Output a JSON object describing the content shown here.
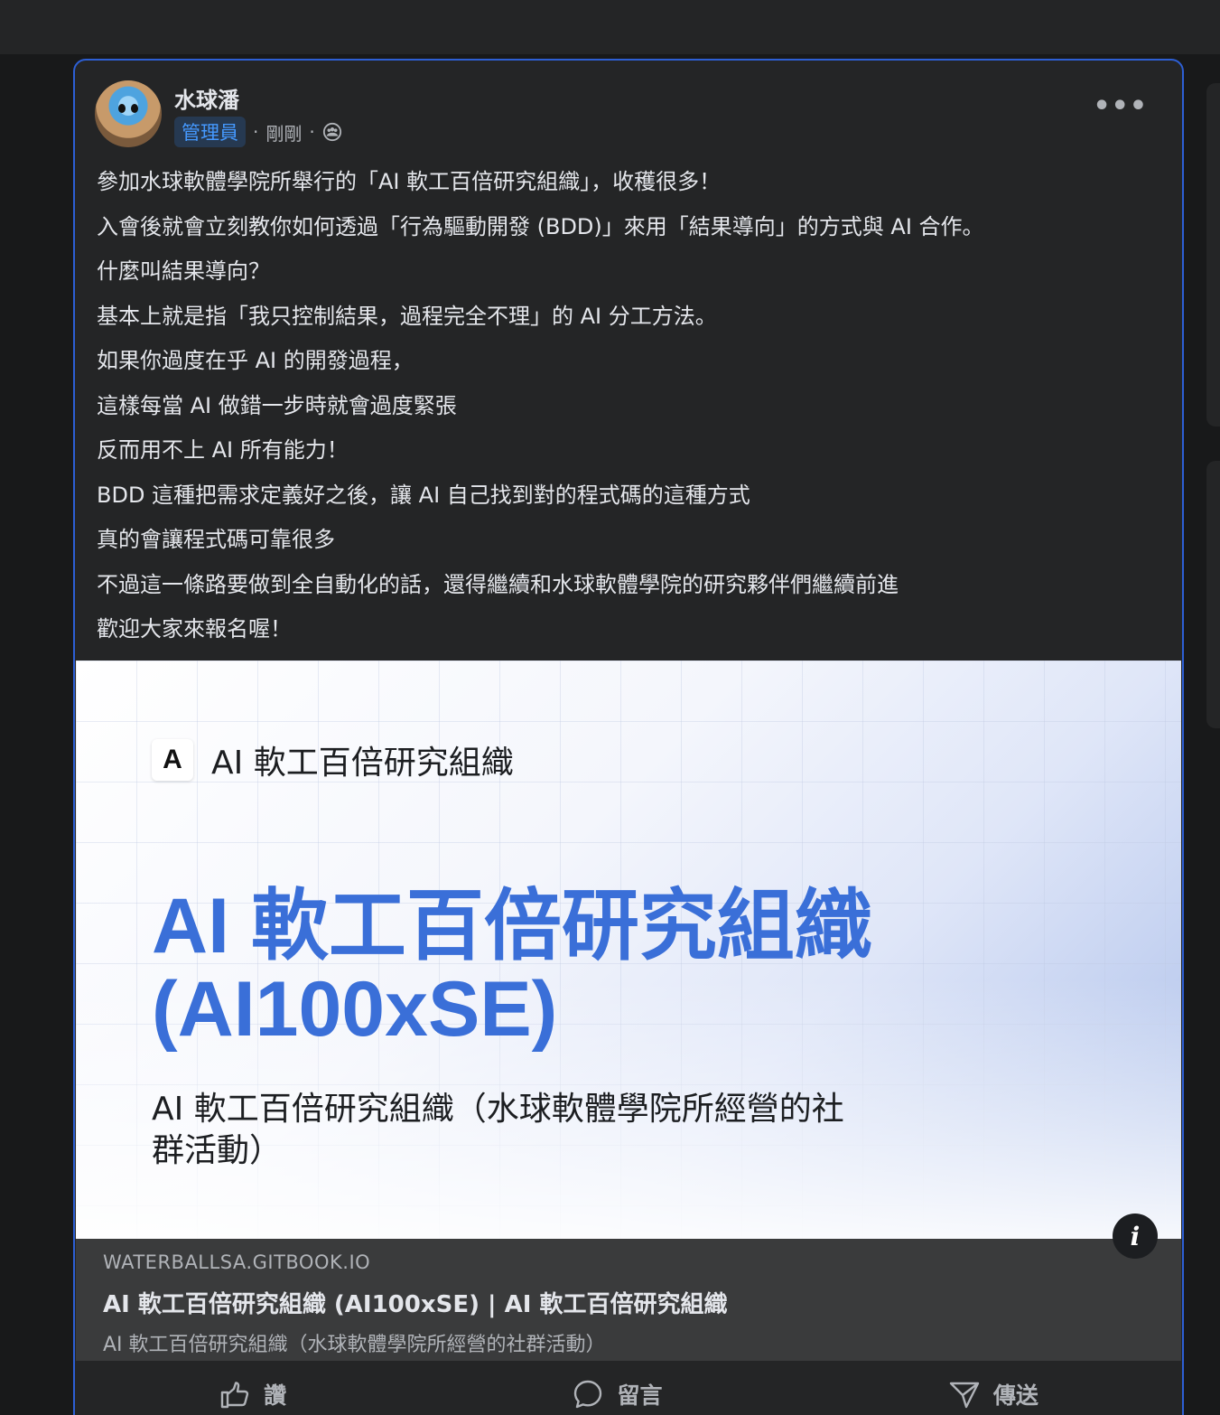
{
  "post": {
    "author": "水球潘",
    "role": "管理員",
    "timestamp": "剛剛",
    "separator": "·",
    "audience_icon": "group-icon",
    "more_label": "•••",
    "body_lines": [
      "參加水球軟體學院所舉行的「AI 軟工百倍研究組織」，收穫很多！",
      "入會後就會立刻教你如何透過「行為驅動開發 (BDD)」來用「結果導向」的方式與 AI 合作。",
      "什麼叫結果導向？",
      "基本上就是指「我只控制結果，過程完全不理」的 AI 分工方法。",
      "如果你過度在乎 AI 的開發過程，",
      "這樣每當 AI 做錯一步時就會過度緊張",
      "反而用不上 AI 所有能力！",
      "BDD 這種把需求定義好之後，讓 AI 自己找到對的程式碼的這種方式",
      "真的會讓程式碼可靠很多",
      "不過這一條路要做到全自動化的話，還得繼續和水球軟體學院的研究夥伴們繼續前進",
      "歡迎大家來報名喔！"
    ]
  },
  "preview": {
    "brand_logo": "A",
    "brand_name": "AI 軟工百倍研究組織",
    "hero_title": "AI 軟工百倍研究組織 (AI100xSE)",
    "hero_subtitle": "AI 軟工百倍研究組織（水球軟體學院所經營的社群活動）",
    "info_icon": "i"
  },
  "link": {
    "domain": "WATERBALLSA.GITBOOK.IO",
    "title": "AI 軟工百倍研究組織 (AI100xSE) | AI 軟工百倍研究組織",
    "description": "AI 軟工百倍研究組織（水球軟體學院所經營的社群活動）"
  },
  "actions": {
    "like": "讚",
    "comment": "留言",
    "share": "傳送"
  },
  "colors": {
    "accent": "#2d5fd4",
    "hero_blue": "#3a6fd8",
    "card_bg": "#242526"
  }
}
